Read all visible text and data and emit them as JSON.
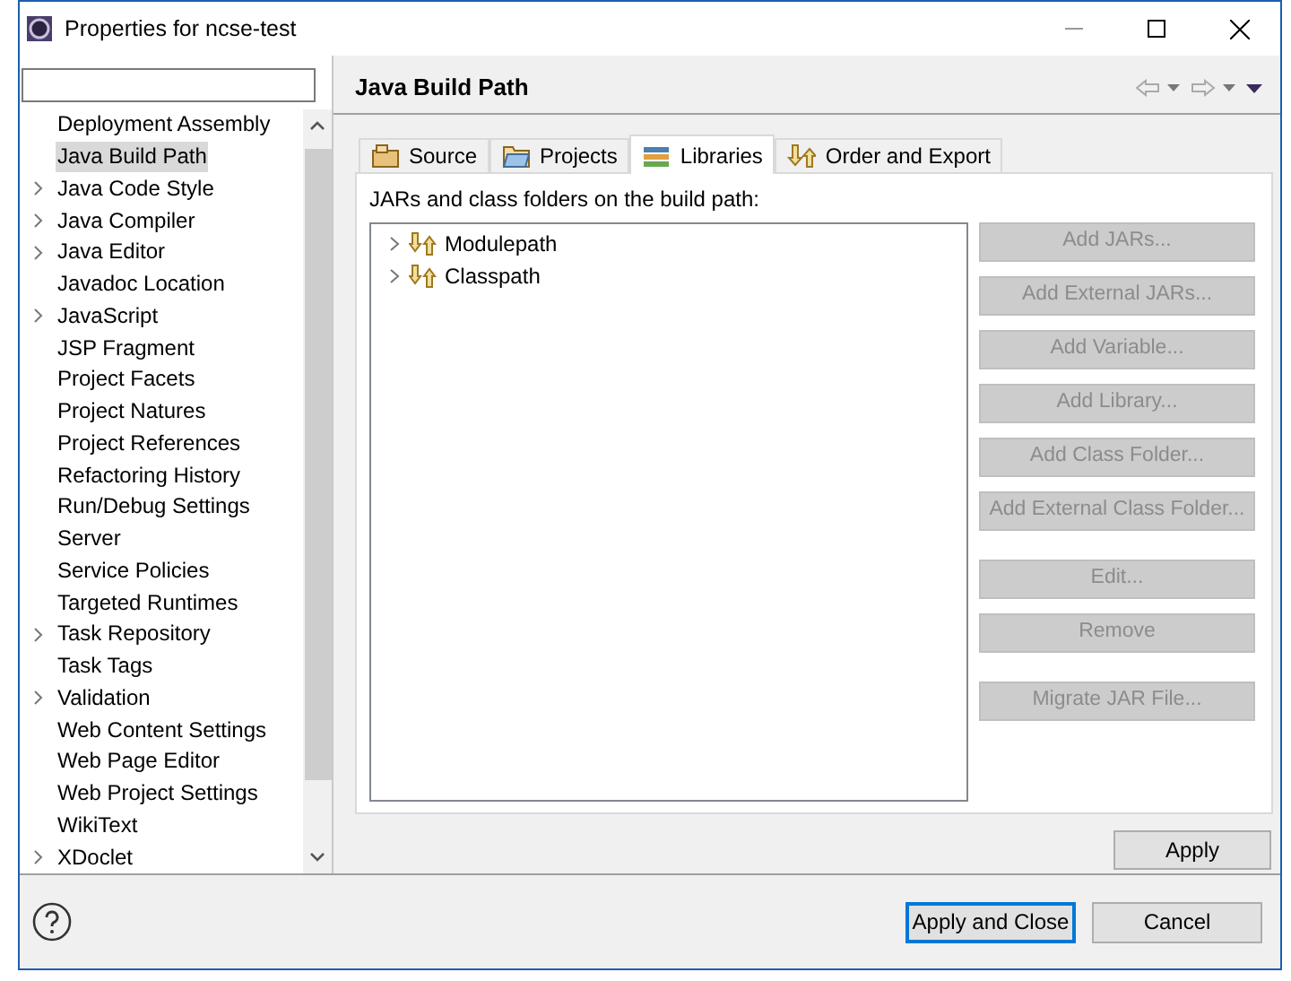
{
  "window": {
    "title": "Properties for ncse-test"
  },
  "sidebar": {
    "items": [
      {
        "label": "Deployment Assembly",
        "expandable": false,
        "selected": false
      },
      {
        "label": "Java Build Path",
        "expandable": false,
        "selected": true
      },
      {
        "label": "Java Code Style",
        "expandable": true,
        "selected": false
      },
      {
        "label": "Java Compiler",
        "expandable": true,
        "selected": false
      },
      {
        "label": "Java Editor",
        "expandable": true,
        "selected": false
      },
      {
        "label": "Javadoc Location",
        "expandable": false,
        "selected": false
      },
      {
        "label": "JavaScript",
        "expandable": true,
        "selected": false
      },
      {
        "label": "JSP Fragment",
        "expandable": false,
        "selected": false
      },
      {
        "label": "Project Facets",
        "expandable": false,
        "selected": false
      },
      {
        "label": "Project Natures",
        "expandable": false,
        "selected": false
      },
      {
        "label": "Project References",
        "expandable": false,
        "selected": false
      },
      {
        "label": "Refactoring History",
        "expandable": false,
        "selected": false
      },
      {
        "label": "Run/Debug Settings",
        "expandable": false,
        "selected": false
      },
      {
        "label": "Server",
        "expandable": false,
        "selected": false
      },
      {
        "label": "Service Policies",
        "expandable": false,
        "selected": false
      },
      {
        "label": "Targeted Runtimes",
        "expandable": false,
        "selected": false
      },
      {
        "label": "Task Repository",
        "expandable": true,
        "selected": false
      },
      {
        "label": "Task Tags",
        "expandable": false,
        "selected": false
      },
      {
        "label": "Validation",
        "expandable": true,
        "selected": false
      },
      {
        "label": "Web Content Settings",
        "expandable": false,
        "selected": false
      },
      {
        "label": "Web Page Editor",
        "expandable": false,
        "selected": false
      },
      {
        "label": "Web Project Settings",
        "expandable": false,
        "selected": false
      },
      {
        "label": "WikiText",
        "expandable": false,
        "selected": false
      },
      {
        "label": "XDoclet",
        "expandable": true,
        "selected": false
      }
    ]
  },
  "page": {
    "title": "Java Build Path",
    "tabs": [
      {
        "label": "Source",
        "selected": false
      },
      {
        "label": "Projects",
        "selected": false
      },
      {
        "label": "Libraries",
        "selected": true
      },
      {
        "label": "Order and Export",
        "selected": false
      }
    ],
    "caption": "JARs and class folders on the build path:",
    "tree": [
      {
        "label": "Modulepath",
        "expanded": false
      },
      {
        "label": "Classpath",
        "expanded": false
      }
    ],
    "button_groups": [
      [
        {
          "label": "Add JARs...",
          "disabled": true
        },
        {
          "label": "Add External JARs...",
          "disabled": true
        },
        {
          "label": "Add Variable...",
          "disabled": true
        },
        {
          "label": "Add Library...",
          "disabled": true
        },
        {
          "label": "Add Class Folder...",
          "disabled": true
        },
        {
          "label": "Add External Class Folder...",
          "disabled": true
        }
      ],
      [
        {
          "label": "Edit...",
          "disabled": true
        },
        {
          "label": "Remove",
          "disabled": true
        }
      ],
      [
        {
          "label": "Migrate JAR File...",
          "disabled": true
        }
      ]
    ],
    "apply": "Apply"
  },
  "footer": {
    "buttons": [
      {
        "label": "Apply and Close",
        "default": true
      },
      {
        "label": "Cancel",
        "default": false
      }
    ]
  }
}
